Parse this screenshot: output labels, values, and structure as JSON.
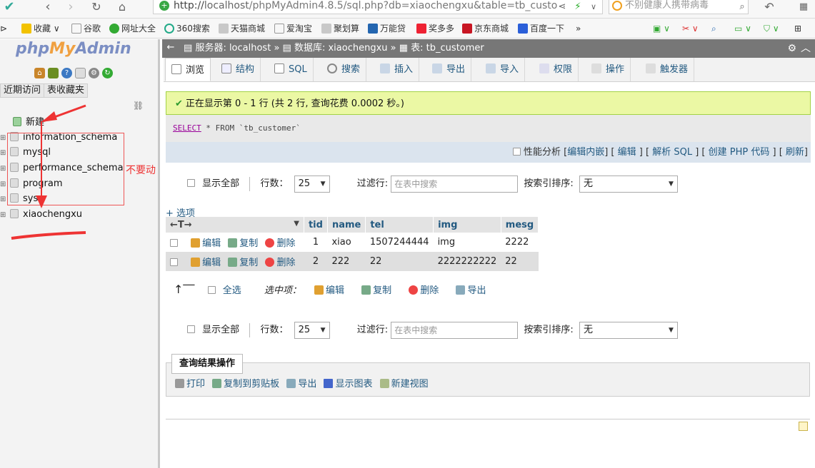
{
  "browser": {
    "url_scheme": "http://",
    "url_host": "localhost",
    "url_path": "/phpMyAdmin4.8.5/sql.php?db=xiaochengxu&table=tb_custo",
    "search_placeholder": "不别健康人携带病毒",
    "bookmarks": [
      "收藏",
      "谷歌",
      "网址大全",
      "360搜索",
      "天猫商城",
      "爱淘宝",
      "聚划算",
      "万能贷",
      "奖多多",
      "京东商城",
      "百度一下",
      "»"
    ]
  },
  "nav": {
    "logo_php": "php",
    "logo_my": "My",
    "logo_admin": "Admin",
    "recent_tab": "近期访问",
    "favorites_tab": "表收藏夹",
    "new_label": "新建",
    "databases": [
      "information_schema",
      "mysql",
      "performance_schema",
      "program",
      "sys",
      "xiaochengxu"
    ]
  },
  "annotation": {
    "dont_touch": "不要动"
  },
  "header": {
    "breadcrumb_server": "服务器: localhost",
    "breadcrumb_db": "数据库: xiaochengxu",
    "breadcrumb_table": "表: tb_customer"
  },
  "tabs": [
    "浏览",
    "结构",
    "SQL",
    "搜索",
    "插入",
    "导出",
    "导入",
    "权限",
    "操作",
    "触发器"
  ],
  "result": {
    "success_message": "正在显示第 0 - 1 行 (共 2 行, 查询花费 0.0002 秒。)",
    "sql_keyword": "SELECT",
    "sql_rest": " * FROM `tb_customer`",
    "profiling": "性能分析",
    "actions": [
      "编辑内嵌",
      "编辑",
      "解析 SQL",
      "创建 PHP 代码",
      "刷新"
    ]
  },
  "controls": {
    "show_all": "显示全部",
    "rows_label": "行数：",
    "rows_value": "25",
    "filter_label": "过滤行:",
    "filter_placeholder": "在表中搜索",
    "sort_label": "按索引排序:",
    "sort_value": "无"
  },
  "table": {
    "options_link": "+ 选项",
    "arrows": "←T→",
    "columns": [
      "tid",
      "name",
      "tel",
      "img",
      "mesg"
    ],
    "edit": "编辑",
    "copy": "复制",
    "delete": "删除",
    "rows": [
      [
        "1",
        "xiao",
        "1507244444",
        "img",
        "2222"
      ],
      [
        "2",
        "222",
        "22",
        "2222222222",
        "22"
      ]
    ]
  },
  "bulk": {
    "select_all": "全选",
    "with_selected": "选中项：",
    "edit": "编辑",
    "copy": "复制",
    "delete": "删除",
    "export": "导出"
  },
  "query_results": {
    "title": "查询结果操作",
    "print": "打印",
    "copy_clipboard": "复制到剪贴板",
    "export": "导出",
    "chart": "显示图表",
    "create_view": "新建视图"
  },
  "colors": {
    "header_bg": "#777777",
    "success_bg": "#ebf8a4",
    "link": "#235a81",
    "annotation": "#ee3333"
  }
}
